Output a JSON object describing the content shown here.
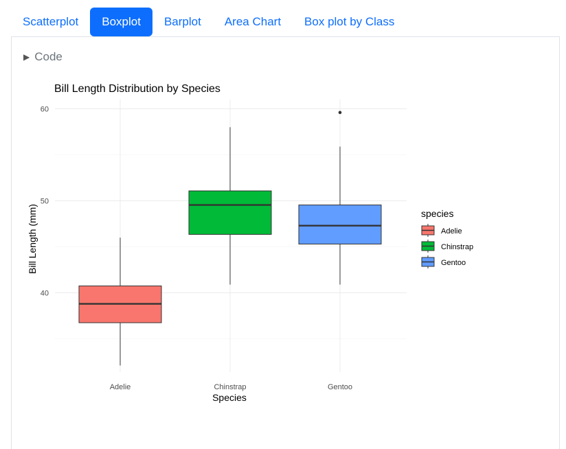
{
  "tabs": [
    {
      "label": "Scatterplot",
      "active": false
    },
    {
      "label": "Boxplot",
      "active": true
    },
    {
      "label": "Barplot",
      "active": false
    },
    {
      "label": "Area Chart",
      "active": false
    },
    {
      "label": "Box plot by Class",
      "active": false
    }
  ],
  "code_toggle": {
    "label": "Code"
  },
  "chart_data": {
    "type": "boxplot",
    "title": "Bill Length Distribution by Species",
    "xlabel": "Species",
    "ylabel": "Bill Length (mm)",
    "ylim": [
      31,
      61
    ],
    "yticks": [
      40,
      50,
      60
    ],
    "grid": true,
    "legend_title": "species",
    "legend_position": "right",
    "categories": [
      "Adelie",
      "Chinstrap",
      "Gentoo"
    ],
    "boxes": [
      {
        "name": "Adelie",
        "color": "#F8766D",
        "min": 32.1,
        "q1": 36.75,
        "median": 38.8,
        "q3": 40.75,
        "max": 46.0,
        "outliers": []
      },
      {
        "name": "Chinstrap",
        "color": "#00BA38",
        "min": 40.9,
        "q1": 46.35,
        "median": 49.55,
        "q3": 51.08,
        "max": 58.0,
        "outliers": []
      },
      {
        "name": "Gentoo",
        "color": "#619CFF",
        "min": 40.9,
        "q1": 45.3,
        "median": 47.3,
        "q3": 49.55,
        "max": 55.9,
        "outliers": [
          59.6
        ]
      }
    ]
  }
}
